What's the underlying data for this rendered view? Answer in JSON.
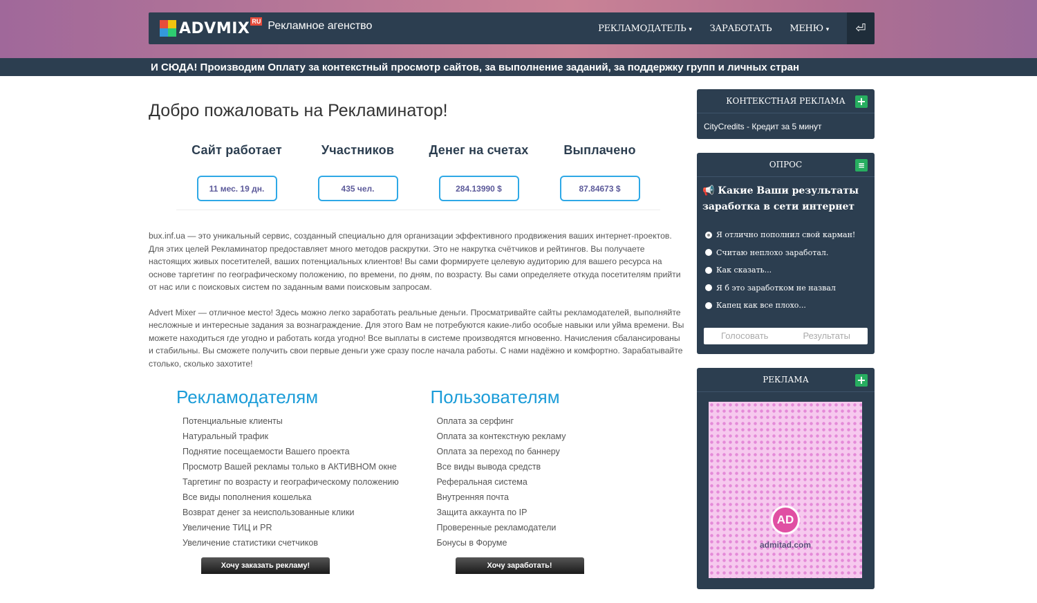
{
  "brand": {
    "name": "ADVMIX",
    "tld": "RU",
    "tagline": "Рекламное агенство"
  },
  "nav": {
    "items": [
      {
        "label": "РЕКЛАМОДАТЕЛЬ",
        "caret": "▾"
      },
      {
        "label": "ЗАРАБОТАТЬ",
        "caret": ""
      },
      {
        "label": "МЕНЮ",
        "caret": "▾"
      }
    ],
    "logout_icon": "⏎"
  },
  "ticker": "И СЮДА! Производим Оплату за контекстный просмотр сайтов, за выполнение заданий, за поддержку групп и личных стран",
  "main": {
    "welcome": "Добро пожаловать на Рекламинатор!",
    "stats": [
      {
        "label": "Сайт работает",
        "value": "11 мес. 19 дн."
      },
      {
        "label": "Участников",
        "value": "435 чел."
      },
      {
        "label": "Денег на счетах",
        "value": "284.13990 $"
      },
      {
        "label": "Выплачено",
        "value": "87.84673 $"
      }
    ],
    "para1": "bux.inf.ua — это уникальный сервис, созданный специально для организации эффективного продвижения ваших интернет-проектов. Для этих целей Рекламинатор предоставляет много методов раскрутки. Это не накрутка счётчиков и рейтингов. Вы получаете настоящих живых посетителей, ваших потенциальных клиентов! Вы сами формируете целевую аудиторию для вашего ресурса на основе таргетинг по географическому положению, по времени, по дням, по возрасту. Вы сами определяете откуда посетителям прийти от нас или с поисковых систем по заданным вами поисковым запросам.",
    "para2": "Advert Mixer — отличное место! Здесь можно легко заработать реальные деньги. Просматривайте сайты рекламодателей, выполняйте несложные и интересные задания за вознаграждение. Для этого Вам не потребуются какие-либо особые навыки или уйма времени. Вы можете находиться где угодно и работать когда угодно! Все выплаты в системе производятся мгновенно. Начисления сбалансированы и стабильны. Вы сможете получить свои первые деньги уже сразу после начала работы. С нами надёжно и комфортно. Зарабатывайте столько, сколько захотите!",
    "advertisers": {
      "title": "Рекламодателям",
      "items": [
        "Потенциальные клиенты",
        "Натуральный трафик",
        "Поднятие посещаемости Вашего проекта",
        "Просмотр Вашей рекламы только в АКТИВНОМ окне",
        "Таргетинг по возрасту и географическому положению",
        "Все виды пополнения кошелька",
        "Возврат денег за неиспользованные клики",
        "Увеличение ТИЦ и PR",
        "Увеличение статистики счетчиков"
      ],
      "button": "Хочу заказать рекламу!"
    },
    "users": {
      "title": "Пользователям",
      "items": [
        "Оплата за серфинг",
        "Оплата за контекстную рекламу",
        "Оплата за переход по баннеру",
        "Все виды вывода средств",
        "Реферальная система",
        "Внутренняя почта",
        "Защита аккаунта по IP",
        "Проверенные рекламодатели",
        "Бонусы в Форуме"
      ],
      "button": "Хочу заработать!"
    }
  },
  "sidebar": {
    "context": {
      "title": "КОНТЕКСТНАЯ РЕКЛАМА",
      "item": "CityCredits - Кредит за 5 минут"
    },
    "poll": {
      "title": "ОПРОС",
      "icon": "📢",
      "question": "Какие Ваши результаты заработка в сети интернет",
      "options": [
        "Я отлично пополнил свой карман!",
        "Считаю неплохо заработал.",
        "Как сказать...",
        "Я б это заработком не назвал",
        "Капец как все плохо..."
      ],
      "vote": "Голосовать",
      "results": "Результаты"
    },
    "ad": {
      "title": "РЕКЛАМА",
      "logo": "AD",
      "site": "admitad.com"
    }
  },
  "colors": {
    "navbar": "#2c3e50",
    "accent": "#1b9cd8",
    "plus": "#27ae60"
  }
}
